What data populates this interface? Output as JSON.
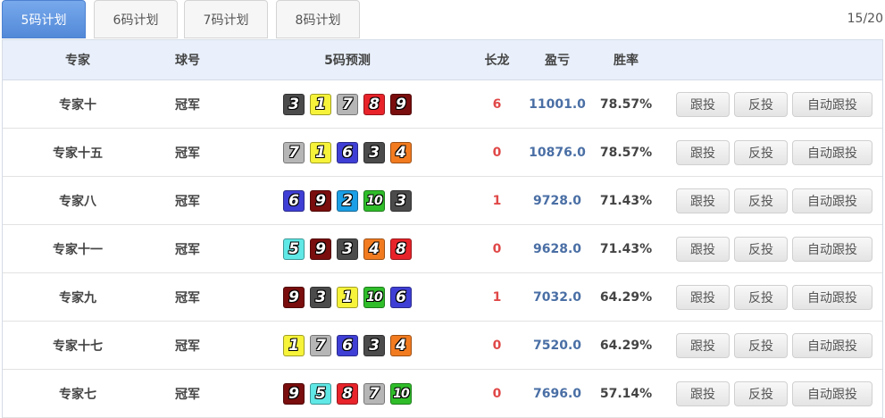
{
  "tabs": [
    {
      "label": "5码计划",
      "active": true
    },
    {
      "label": "6码计划",
      "active": false
    },
    {
      "label": "7码计划",
      "active": false
    },
    {
      "label": "8码计划",
      "active": false
    }
  ],
  "page_count": "15/20",
  "headers": {
    "expert": "专家",
    "ball": "球号",
    "prediction": "5码预测",
    "long": "长龙",
    "profit": "盈亏",
    "rate": "胜率"
  },
  "buttons": {
    "follow": "跟投",
    "reverse": "反投",
    "auto": "自动跟投"
  },
  "ball_colors": {
    "1": "#f6f33a",
    "2": "#1b9fe6",
    "3": "#4b4b4b",
    "4": "#f27b20",
    "5": "#5fe8e6",
    "6": "#3f3fd6",
    "7": "#b6b6b6",
    "8": "#e8232a",
    "9": "#7a0d0d",
    "10": "#2fbd2a"
  },
  "rows": [
    {
      "expert": "专家十",
      "ball": "冠军",
      "balls": [
        "3",
        "1",
        "7",
        "8",
        "9"
      ],
      "long": "6",
      "profit": "11001.0",
      "rate": "78.57%"
    },
    {
      "expert": "专家十五",
      "ball": "冠军",
      "balls": [
        "7",
        "1",
        "6",
        "3",
        "4"
      ],
      "long": "0",
      "profit": "10876.0",
      "rate": "78.57%"
    },
    {
      "expert": "专家八",
      "ball": "冠军",
      "balls": [
        "6",
        "9",
        "2",
        "10",
        "3"
      ],
      "long": "1",
      "profit": "9728.0",
      "rate": "71.43%"
    },
    {
      "expert": "专家十一",
      "ball": "冠军",
      "balls": [
        "5",
        "9",
        "3",
        "4",
        "8"
      ],
      "long": "0",
      "profit": "9628.0",
      "rate": "71.43%"
    },
    {
      "expert": "专家九",
      "ball": "冠军",
      "balls": [
        "9",
        "3",
        "1",
        "10",
        "6"
      ],
      "long": "1",
      "profit": "7032.0",
      "rate": "64.29%"
    },
    {
      "expert": "专家十七",
      "ball": "冠军",
      "balls": [
        "1",
        "7",
        "6",
        "3",
        "4"
      ],
      "long": "0",
      "profit": "7520.0",
      "rate": "64.29%"
    },
    {
      "expert": "专家七",
      "ball": "冠军",
      "balls": [
        "9",
        "5",
        "8",
        "7",
        "10"
      ],
      "long": "0",
      "profit": "7696.0",
      "rate": "57.14%"
    }
  ]
}
